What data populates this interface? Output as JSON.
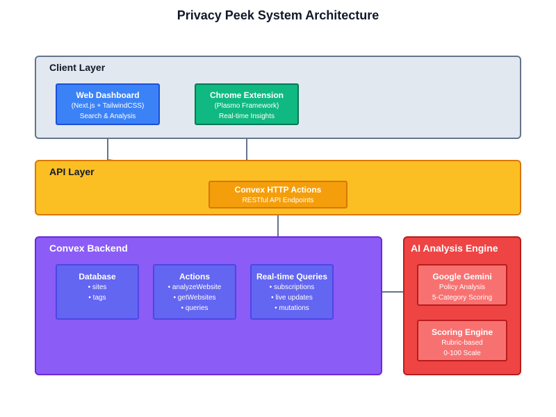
{
  "title": "Privacy Peek System Architecture",
  "colors": {
    "client_layer": "#e2e8f0",
    "api_layer": "#fbbf24",
    "backend": "#8b5cf6",
    "ai_engine": "#ef4444",
    "web_dashboard": "#3b82f6",
    "chrome_extension": "#10b981",
    "convex_http": "#f59e0b",
    "backend_box": "#6366f1",
    "ai_box": "#f87171"
  },
  "client_layer": {
    "label": "Client Layer",
    "web_dashboard": {
      "title": "Web Dashboard",
      "lines": [
        "(Next.js + TailwindCSS)",
        "Search & Analysis"
      ]
    },
    "chrome_extension": {
      "title": "Chrome Extension",
      "lines": [
        "(Plasmo Framework)",
        "Real-time Insights"
      ]
    }
  },
  "api_layer": {
    "label": "API Layer",
    "convex_http": {
      "title": "Convex HTTP Actions",
      "lines": [
        "RESTful API Endpoints"
      ]
    }
  },
  "backend": {
    "label": "Convex Backend",
    "database": {
      "title": "Database",
      "lines": [
        "• sites",
        "• tags"
      ]
    },
    "actions": {
      "title": "Actions",
      "lines": [
        "• analyzeWebsite",
        "• getWebsites",
        "• queries"
      ]
    },
    "realtime": {
      "title": "Real-time Queries",
      "lines": [
        "• subscriptions",
        "• live updates",
        "• mutations"
      ]
    }
  },
  "ai_engine": {
    "label": "AI Analysis Engine",
    "gemini": {
      "title": "Google Gemini",
      "lines": [
        "Policy Analysis",
        "5-Category Scoring"
      ]
    },
    "scoring": {
      "title": "Scoring Engine",
      "lines": [
        "Rubric-based",
        "0-100 Scale"
      ]
    }
  }
}
